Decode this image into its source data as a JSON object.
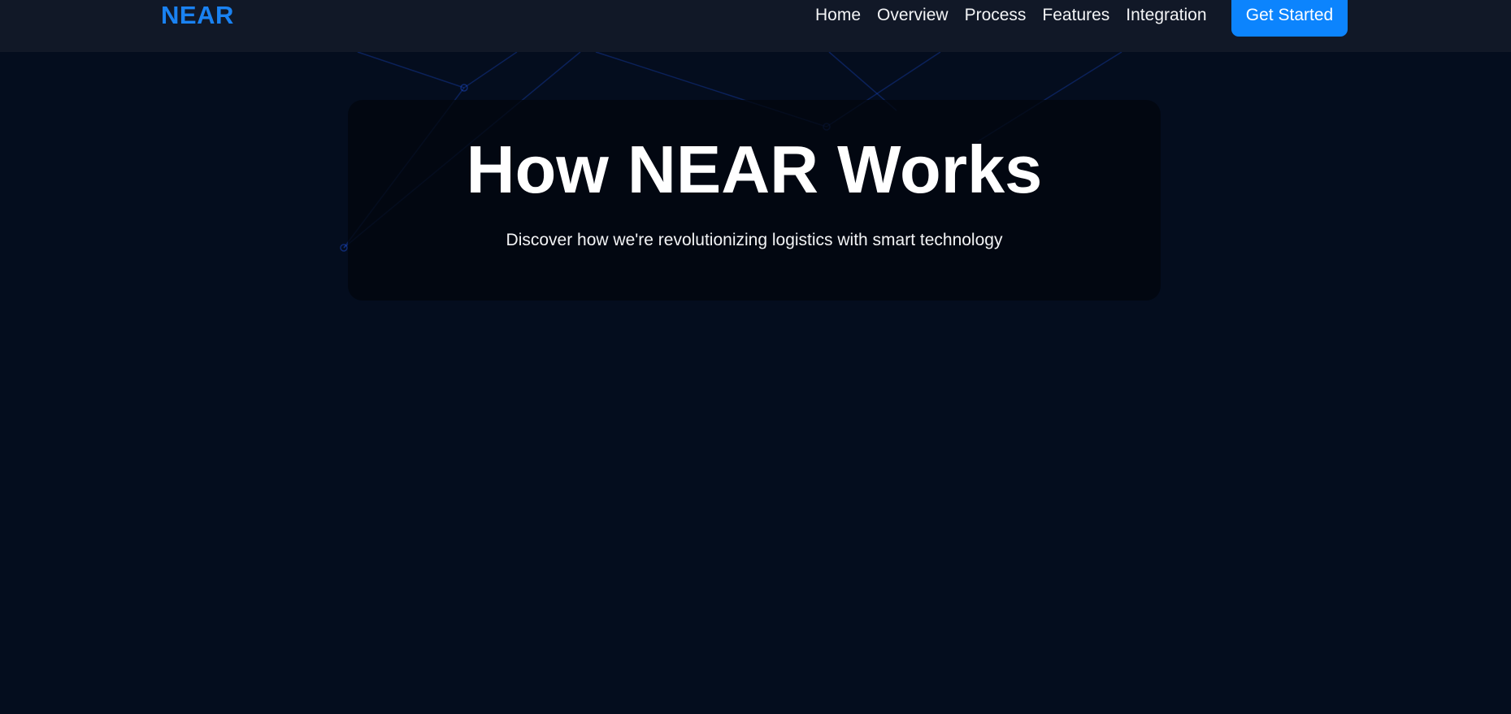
{
  "nav": {
    "logo": "NEAR",
    "links": [
      {
        "label": "Home"
      },
      {
        "label": "Overview"
      },
      {
        "label": "Process"
      },
      {
        "label": "Features"
      },
      {
        "label": "Integration"
      }
    ],
    "cta_label": "Get Started"
  },
  "hero": {
    "title": "How NEAR Works",
    "subtitle": "Discover how we're revolutionizing logistics with smart technology"
  },
  "colors": {
    "background": "#040d1e",
    "navbar": "#111827",
    "accent": "#0c84fd",
    "logo": "#1a82f2",
    "text": "#ffffff"
  }
}
